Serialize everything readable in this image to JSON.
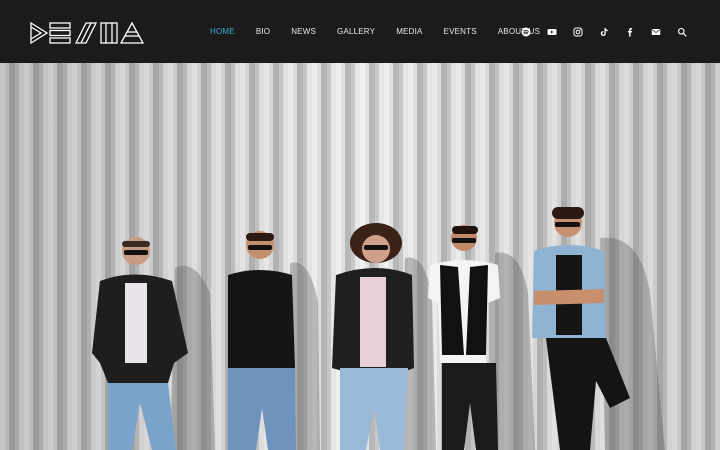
{
  "brand": {
    "name": "DESMA"
  },
  "nav": {
    "items": [
      {
        "label": "HOME",
        "active": true
      },
      {
        "label": "BIO",
        "active": false
      },
      {
        "label": "NEWS",
        "active": false
      },
      {
        "label": "GALLERY",
        "active": false
      },
      {
        "label": "MEDIA",
        "active": false
      },
      {
        "label": "EVENTS",
        "active": false
      },
      {
        "label": "ABOUT US",
        "active": false
      }
    ]
  },
  "social": [
    "spotify-icon",
    "youtube-icon",
    "instagram-icon",
    "tiktok-icon",
    "facebook-icon",
    "email-icon",
    "search-icon"
  ],
  "colors": {
    "header_bg": "#1b1b1b",
    "nav_text": "#e8e8e8",
    "nav_active": "#3fa9d6",
    "wall": "#c9c9c9"
  },
  "hero": {
    "subject": "band-photo"
  }
}
